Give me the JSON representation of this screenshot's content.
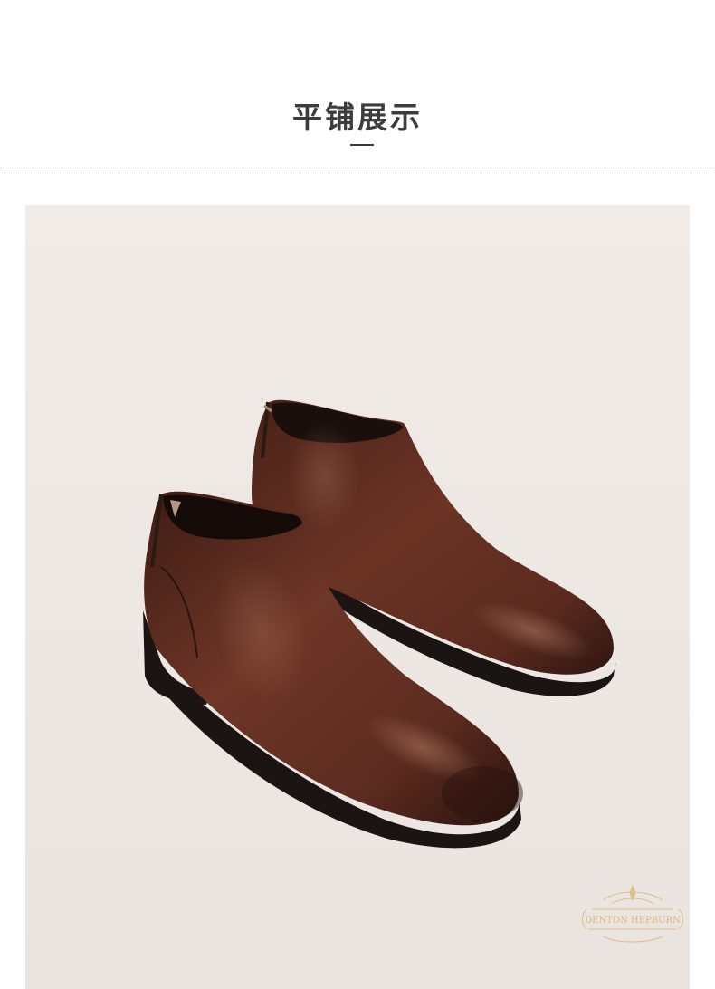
{
  "section": {
    "title": "平铺展示"
  },
  "product_photo": {
    "subject": "pair-of-dark-brown-leather-chelsea-ankle-boots",
    "background_color": "#eee8e4",
    "leather_color": "#5a2a1e",
    "sole_color": "#1a1413"
  },
  "watermark": {
    "brand_text": "DENTON HEPBURN",
    "color": "#d9b878"
  }
}
